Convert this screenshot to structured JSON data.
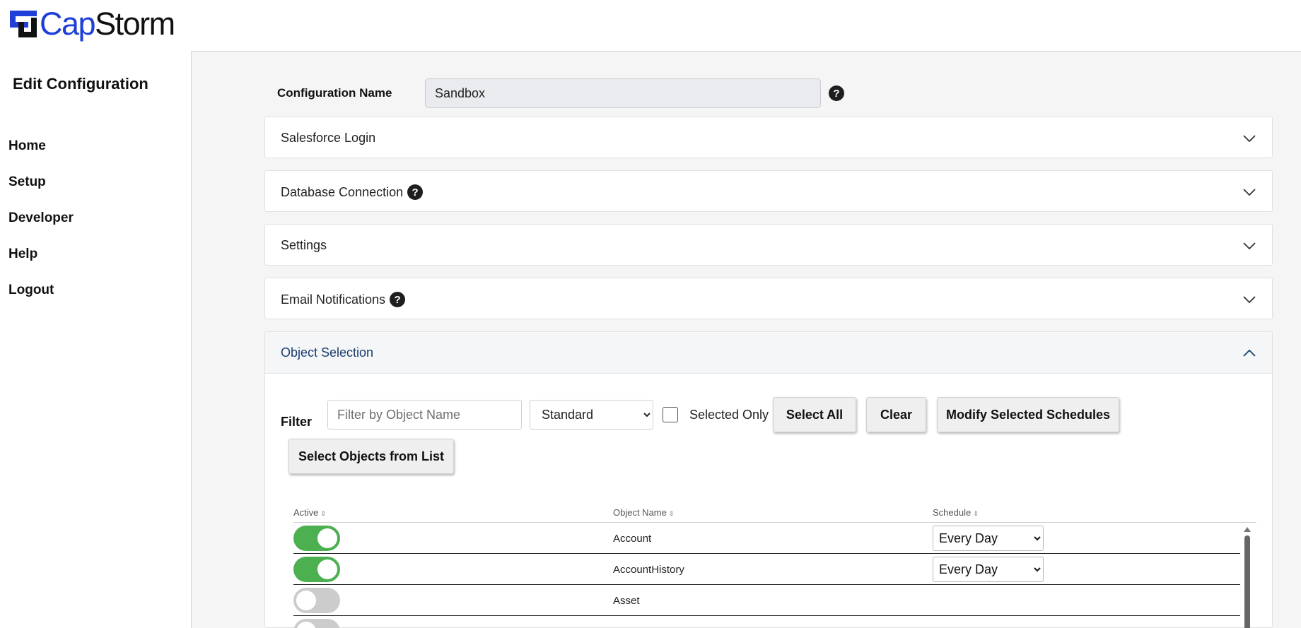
{
  "brand": {
    "name_part1": "Cap",
    "name_part2": "Storm",
    "accent_color": "#1f3fd6"
  },
  "sidebar": {
    "title": "Edit Configuration",
    "items": [
      {
        "label": "Home"
      },
      {
        "label": "Setup"
      },
      {
        "label": "Developer"
      },
      {
        "label": "Help"
      },
      {
        "label": "Logout"
      }
    ]
  },
  "config": {
    "label": "Configuration Name",
    "value": "Sandbox",
    "help_glyph": "?"
  },
  "sections": [
    {
      "title": "Salesforce Login",
      "expanded": false,
      "has_help": false
    },
    {
      "title": "Database Connection",
      "expanded": false,
      "has_help": true
    },
    {
      "title": "Settings",
      "expanded": false,
      "has_help": false
    },
    {
      "title": "Email Notifications",
      "expanded": false,
      "has_help": true
    },
    {
      "title": "Object Selection",
      "expanded": true,
      "has_help": false
    }
  ],
  "object_selection": {
    "filter_label": "Filter",
    "filter_placeholder": "Filter by Object Name",
    "type_selected": "Standard",
    "selected_only_label": "Selected Only",
    "selected_only_checked": false,
    "select_all_label": "Select All",
    "clear_label": "Clear",
    "modify_label": "Modify Selected Schedules",
    "select_from_list_label": "Select Objects from List",
    "columns": [
      "Active",
      "Object Name",
      "Schedule"
    ],
    "sort_glyph": "⇕",
    "rows": [
      {
        "active": true,
        "name": "Account",
        "schedule": "Every Day"
      },
      {
        "active": true,
        "name": "AccountHistory",
        "schedule": "Every Day"
      },
      {
        "active": false,
        "name": "Asset",
        "schedule": ""
      }
    ],
    "toggle_on_color": "#4caf50",
    "toggle_off_color": "#cccccc"
  }
}
